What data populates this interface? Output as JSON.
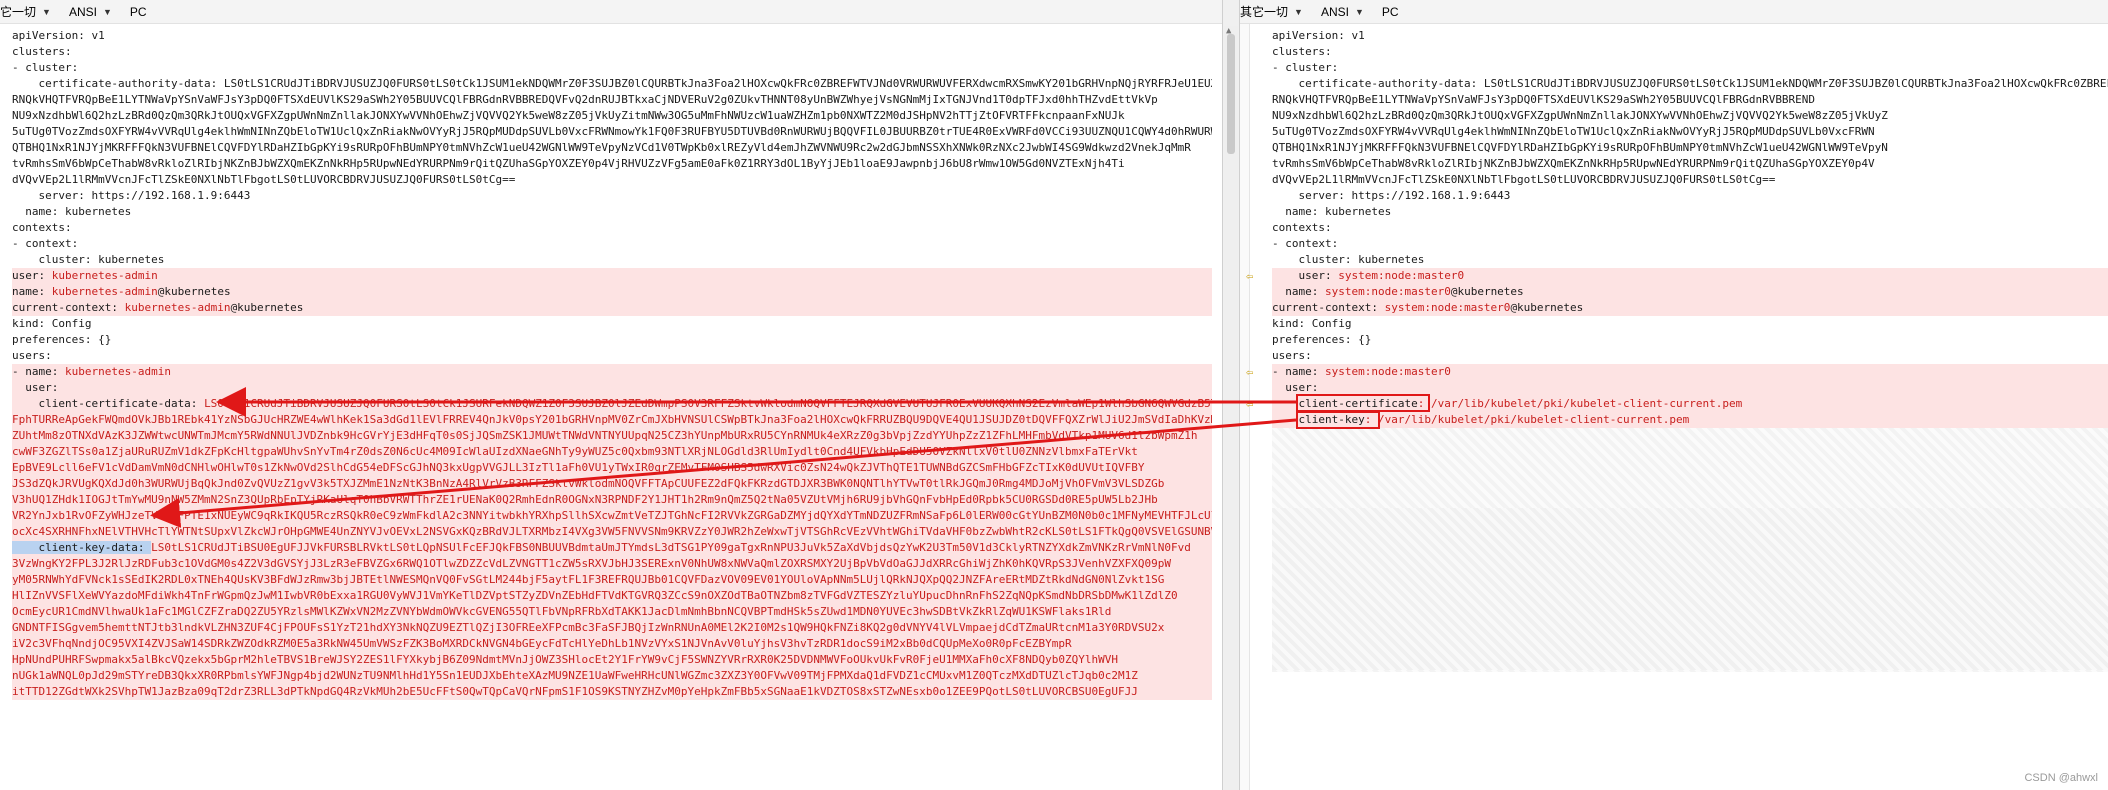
{
  "toolbar_left": {
    "encoding_menu": "它一切",
    "charset": "ANSI",
    "line_ending": "PC"
  },
  "toolbar_right": {
    "encoding_menu": "其它一切",
    "charset": "ANSI",
    "line_ending": "PC"
  },
  "left": {
    "lines": [
      {
        "t": "apiVersion: v1"
      },
      {
        "t": "clusters:"
      },
      {
        "t": "- cluster:"
      },
      {
        "t": "    certificate-authority-data: LS0tLS1CRUdJTiBDRVJUSUZJQ0FURS0tLS0tCk1JSUM1ekNDQWMrZ0F3SUJBZ0lCQURBTkJna3Foa2lHOXcwQkFRc0ZBREFWTVJNd0VRWURWUVFERXdwcmRXSmwKY201bGRHVnpNQjRYRFRJeU1EUXlNVEEyTkRJeU5Gb1hEVE15TURReE9EQTJOREl5TkZvd0ZURVRNQkVHQTFVRQpBeE1LYTNWaVpYSnVaWFJsY3pDQ0FTSXdEUVlKS29aSWh2Y05BUUVCQlFBRGdnRVBBREND"
      },
      {
        "t": "RNQkVHQTFVRQpBeE1LYTNWaVpYSnVaWFJsY3pDQ0FTSXdEUVlKS29aSWh2Y05BUUVCQlFBRGdnRVBBREDQVFvQ2dnRUJBTkxaCjNDVERuV2g0ZUkvTHNNT08yUnBWZWhyejVsNGNmMjIxTGNJVnd1T0dpTFJxd0hhTHZvdEttVkVp"
      },
      {
        "t": "NU9xNzdhbWl6Q2hzLzBRd0QzQm3QRkJtOUQxVGFXZgpUWnNmZnllakJONXYwVVNhOEhwZjVQVVQ2Yk5weW8zZ05jVkUyZitmNWw3OG5uMmFhNWUzcW1uaWZHZm1pb0NXWTZ2M0dJSHpNV2hTTjZtOFVRTFFkcnpaanFxNUJk"
      },
      {
        "t": "5uTUg0TVozZmdsOXFYRW4vVVRqUlg4eklhWmNINnZQbEloTW1UclQxZnRiakNwOVYyRjJ5RQpMUDdpSUVLb0VxcFRWNmowYk1FQ0F3RUFBYU5DTUVBd0RnWURWUjBQQVFIL0JBUURBZ0trTUE4R0ExVWRFd0VCCi93UUZNQU1CQWY4d0hRWURWUjBP"
      },
      {
        "t": "QTBHQ1NxR1NJYjMKRFFFQkN3VUFBNElCQVFDYlRDaHZIbGpKYi9sRURpOFhBUmNPY0tmNVhZcW1ueU42WGNlWW9TeVpyNzVCd1V0TWpKb0xlREZyVld4emJhZWVNWU9Rc2w2dGJbmNSSXhXNWk0RzNXc2JwbWI4SG9Wdkwzd2VnekJqMmR"
      },
      {
        "t": "tvRmhsSmV6bWpCeThabW8vRkloZlRIbjNKZnBJbWZXQmEKZnNkRHp5RUpwNEdYRURPNm9rQitQZUhaSGpYOXZEY0p4VjRHVUZzVFg5amE0aFk0Z1RRY3dOL1ByYjJEb1loaE9JawpnbjJ6bU8rWmw1OW5Gd0NVZTExNjh4Ti"
      },
      {
        "t": "dVQvVEp2L1lRMmVVcnJFcTlZSkE0NXlNbTlFbgotLS0tLUVORCBDRVJUSUZJQ0FURS0tLS0tCg=="
      },
      {
        "t": "    server: https://192.168.1.9:6443"
      },
      {
        "t": "  name: kubernetes"
      },
      {
        "t": "contexts:"
      },
      {
        "t": "- context:"
      },
      {
        "t": "    cluster: kubernetes"
      },
      {
        "t": "    user: kubernetes-admin",
        "diff": true,
        "rk": "user: ",
        "rv": "kubernetes-admin"
      },
      {
        "t": "  name: kubernetes-admin@kubernetes",
        "diff": true,
        "rk": "name: ",
        "rv": "kubernetes-admin",
        "rs": "@kubernetes"
      },
      {
        "t": "current-context: kubernetes-admin@kubernetes",
        "diff": true,
        "rk": "current-context: ",
        "rv": "kubernetes-admin",
        "rs": "@kubernetes"
      },
      {
        "t": "kind: Config"
      },
      {
        "t": "preferences: {}"
      },
      {
        "t": "users:"
      },
      {
        "t": "- name: kubernetes-admin",
        "diff": true,
        "rk": "- name: ",
        "rv": "kubernetes-admin"
      },
      {
        "t": "  user:",
        "diff": true
      },
      {
        "t": "    client-certificate-data: LS0tLS1CRUdJTiBDRVJUSUZJQ0FURS0tLS0tCk1JSURFekNDQWZ1Z0F3SUJBZ0lJZEdDWmpPS0V3RFFZSktvWklodmNOQVFFTEJRQXdGVEVUTUJFR0ExVUUKQXhNS2EzVmlaWEp1WlhSbGN6QWVGdzB5TWpBME1qRXdOalF5TWpSYUZ3MHlNekEwTWpFd05qUXlNalphTURReApGekFWQmdOVkJBb1REbk41YzNSbGJUcHRZWE4wWlhKek1Sa3dGd1lEVlFRREV4QnJkV0psY201bGRHVnpMV0ZrCmJXbHVNSUlCSWpBTkJna3Foa2lHOXcwQkFRRUZBQU9DQVE4QU1JSUJDZ0tDQVFFQXZrWlJiU2JmSVdIaDhKVzMKTDNVc0c1Tm1LS3ZDOU0rSVZTUmJYY0VXenZ",
        "diff": true,
        "red": true,
        "key": "    client-certificate-data: "
      },
      {
        "t": "FphTURReApGekFWQmdOVkJBb1REbk41YzNSbGJUcHRZWE4wWlhKek1Sa3dGd1lEVlFRREV4QnJkV0psY201bGRHVnpMV0ZrCmJXbHVNSUlCSWpBTkJna3Foa2lHOXcwQkFRRUZBQU9DQVE4QU1JSUJDZ0tDQVFFQXZrWlJiU2JmSVdIaDhKVzMKTDNVc0c1",
        "diff": true,
        "red": true
      },
      {
        "t": "ZUhtMm8zOTNXdVAzK3JZWWtwcUNWTmJMcmY5RWdNNUlJVDZnbk9HcGVrYjE3dHFqT0s0SjJQSmZSK1JMUWtTNWdVNTNYUUpqN25CZ3hYUnpMbURxRU5CYnRNMUk4eXRzZ0g3bVpjZzdYYUhpZzZ1ZFhLMHFmbVdVTkp1MUV6d1lzbWpmZ1h",
        "diff": true,
        "red": true
      },
      {
        "t": "cwWF3ZGZlTSs0a1ZjaURuRUZmV1dkZFpKcHltgpaWUhvSnYvTm4rZ0dsZ0N6cUc4M09IcWlaUIzdXNaeGNhTy9yWUZ5c0Qxbm93NTlXRjNLOGdld3RlUmIydlt0Cnd4UFVkbHpEdDU5OVZkNllxV0tlU0ZNNzVlbmxFaTErVkt",
        "diff": true,
        "red": true
      },
      {
        "t": "EpBVE9Lcll6eFV1cVdDamVmN0dCNHlwOHlwT0s1ZkNwOVd2SlhCdG54eDFScGJhNQ3kxUgpVVGJLL3IzTl1aFh0VU1yTWxIR0grZEMvTFM0SHBS5dwRXVic0ZsN24wQkZJVThQTE1TUWNBdGZCSmFHbGFZcTIxK0dUVUtIQVFBY",
        "diff": true,
        "red": true
      },
      {
        "t": "JS3dZQkJRVUgKQXdJd0h3WURWUjBqQkJnd0ZvQVUzZ1gvV3k5TXJZMmE1NzNtK3BnNzA4RlVrVzB3RFFZSktvWklodmNOQVFFTApCUUFEZ2dFQkFKRzdGTDJXR3BWK0NQNTlhYTVwT0tlRkJGQmJ0Rmg4MDJoMjVhOFVmV3VLSDZGb",
        "diff": true,
        "red": true
      },
      {
        "t": "V3hUQ1ZHdk1IOGJtTmYwMU9nNW5ZMmN2SnZ3QUpRbEpTYjRKaUlqT0hBbVRWTThrZE1rUENaK0Q2RmhEdnR0OGNxN3RPNDF2Y1JHT1h2Rm9nQmZ5Q2tNa05VZUtVMjh6RU9jbVhGQnFvbHpEd0Rpbk5CU0RGSDd0RE5pUW5Lb2JHb",
        "diff": true,
        "red": true
      },
      {
        "t": "VR2YnJxb1RvOFZyWHJzeTVrSDFPTE1xNUEyWC9qRkIKQU5RczRSQkR0eC9zWmFkdlA2c3NNYitwbkhYRXhpSllhSXcwZmtVeTZJTGhNcFI2RVVkZGRGaDZMYjdQYXdYTmNDZUZFRmNSaFp6L0lERW00cGtYUnBZM0N0b0c1MFNyMEVHTFJLcUl",
        "diff": true,
        "red": true
      },
      {
        "t": "ocXc4SXRHNFhxNElVTHVHcTlYWTNtSUpxVlZkcWJrOHpGMWE4UnZNYVJvOEVxL2NSVGxKQzBRdVJLTXRMbzI4VXg3VW5FNVVSNm9KRVZzY0JWR2hZeWxwTjVTSGhRcVEzVVhtWGhiTVdaVHF0bzZwbWhtR2cKLS0tLS1FTkQgQ0VSVElGSUNBVEUtLS0tLQo=",
        "diff": true,
        "red": true
      },
      {
        "t": "    client-key-data: LS0tLS1CRUdJTiBSU0EgUFJJVkFURSBLRVktLS0tLQpNSUlFcEFJQkFBS0NBUUVBdmtaUmJTYmdsL3dTSG1PY09gaTgxRnNPU3JuVk5ZaXdVbjdsQzYwK2U3Tm50V1d3CklyRTNZYXdkZmVNKzRrVmNlN0Fvd",
        "diff": true,
        "red": true,
        "key": "    client-key-data: ",
        "selected": true
      },
      {
        "t": "3VzWngKY2FPL3J2RlJzRDFub3c1OVdGM0s4Z2V3dGVSYjJ3LzR3eFBVZGx6RWQ1OTlwZDZZcVdLZVNGTT1cZW5sRXVJbHJ3SERExnV0NhUW8xNWVaQmlZOXRSMXY2UjBpVbVdOaGJJdXRRcGhiWjZhK0hKQVRpS3JVenhVZXFXQ09pW",
        "diff": true,
        "red": true
      },
      {
        "t": "yM05RNWhYdFVNck1sSEdIK2RDL0xTNEh4QUsKV3BFdWJzRmw3bjJBTEtlNWESMQnVQ0FvSGtLM244bjF5aytFL1F3REFRQUJBb01CQVFDazVOV09EV01YOUloVApNNm5LUjlQRkNJQXpQQ2JNZFAreERtMDZtRkdNdGN0NlZvkt1SG",
        "diff": true,
        "red": true
      },
      {
        "t": "HlIZnVVSFlXeWVYazdoMFdiWkh4TnFrWGpmQzJwM1IwbVR0bExxa1RGU0VyWVJ1VmYKeTlDZVptSTZyZDVnZEbHdFTVdKTGVRQ3ZCcS9nOXZOdTBaOTNZbm8zTVFGdVZTESZYzluYUpucDhnRnFhS2ZqNQpKSmdNbDRSbDMwK1lZdlZ0",
        "diff": true,
        "red": true
      },
      {
        "t": "OcmEycUR1CmdNVlhwaUk1aFc1MGlCZFZraDQ2ZU5YRzlsMWlKZWxVN2MzZVNYbWdmOWVkcGVENG55QTlFbVNpRFRbXdTAKK1JacDlmNmhBbnNCQVBPTmdHSk5sZUwd1MDN0YUVEc3hwSDBtVkZkRlZqWU1KSWFlaks1Rld",
        "diff": true,
        "red": true
      },
      {
        "t": "GNDNTFISGgvem5hemttNTJtb3lndkVLZHN3ZUF4CjFPOUFsS1YzT21hdXY3NkNQZU9EZTlQZjI3OFREeXFPcmBc3FaSFJBQjIzWnRNUnA0MEl2K2I0M2s1QW9HQkFNZi8KQ2g0dVNYV4lVLVmpaejdCdTZmaURtcnM1a3Y0RDVSU2x",
        "diff": true,
        "red": true
      },
      {
        "t": "iV2c3VFhqNndjOC95VXI4ZVJSaW14SDRkZWZOdkRZM0E5a3RkNW45UmVWSzFZK3BoMXRDCkNVGN4bGEycFdTcHlYeDhLb1NVzVYxS1NJVnAvV0luYjhsV3hvTzRDR1docS9iM2xBb0dCQUpMeXo0R0pFcEZBYmpR",
        "diff": true,
        "red": true
      },
      {
        "t": "HpNUndPUHRFSwpmakx5alBkcVQzekx5bGprM2hleTBVS1BreWJSY2ZES1lFYXkybjB6Z09NdmtMVnJjOWZ3SHlocEt2Y1FrYW9vCjF5SWNZYVRrRXR0K25DVDNMWVFoOUkvUkFvR0FjeU1MMXaFh0cXF8NDQyb0ZQYlhWVH",
        "diff": true,
        "red": true
      },
      {
        "t": "nUGk1aWNQL0pJd29mSTYreDB3QkxXR0RPbmlsYWFJNgp4bjd2WUNzTU9NMlhHd1Y5Sn1EUDJXbEhteXAzMU9NZE1UaWFweHRHcUNlWGZmc3ZXZ3Y0OFVwV09TMjFPMXdaQ1dFVDZ1cCMUxvM1Z0QTczMXdDTUZlcTJqb0c2M1Z",
        "diff": true,
        "red": true
      },
      {
        "t": "itTTD12ZGdtWXk2SVhpTW1JazBza09qT2drZ3RLL3dPTkNpdGQ4RzVkMUh2bE5UcFFtS0QwTQpCaVQrNFpmS1F1OS9KSTNYZHZvM0pYeHpkZmFBb5xSGNaaE1kVDZTOS8xSTZwNEsxb0o1ZEE9PQotLS0tLUVORCBSU0EgUFJJ",
        "diff": true,
        "red": true
      }
    ]
  },
  "right": {
    "lines": [
      {
        "t": "apiVersion: v1"
      },
      {
        "t": "clusters:"
      },
      {
        "t": "- cluster:"
      },
      {
        "t": "    certificate-authority-data: LS0tLS1CRUdJTiBDRVJUSUZJQ0FURS0tLS0tCk1JSUM1ekNDQWMrZ0F3SUJBZ0lCQURBTkJna3Foa2lHOXcwQkFRc0ZBREFWTVJNd0VRWURWUVFERXdwcmRXSmwKY201bGRHVnpNQjRYRFRJeU1EUXlNVEEy"
      },
      {
        "t": "RNQkVHQTFVRQpBeE1LYTNWaVpYSnVaWFJsY3pDQ0FTSXdEUVlKS29aSWh2Y05BUUVCQlFBRGdnRVBBREND"
      },
      {
        "t": "NU9xNzdhbWl6Q2hzLzBRd0QzQm3QRkJtOUQxVGFXZgpUWnNmZnllakJONXYwVVNhOEhwZjVQVVQ2Yk5weW8zZ05jVkUyZ"
      },
      {
        "t": "5uTUg0TVozZmdsOXFYRW4vVVRqUlg4eklhWmNINnZQbEloTW1UclQxZnRiakNwOVYyRjJ5RQpMUDdpSUVLb0VxcFRWN"
      },
      {
        "t": "QTBHQ1NxR1NJYjMKRFFFQkN3VUFBNElCQVFDYlRDaHZIbGpKYi9sRURpOFhBUmNPY0tmNVhZcW1ueU42WGNlWW9TeVpyN"
      },
      {
        "t": "tvRmhsSmV6bWpCeThabW8vRkloZlRIbjNKZnBJbWZXQmEKZnNkRHp5RUpwNEdYRURPNm9rQitQZUhaSGpYOXZEY0p4V"
      },
      {
        "t": "dVQvVEp2L1lRMmVVcnJFcTlZSkE0NXlNbTlFbgotLS0tLUVORCBDRVJUSUZJQ0FURS0tLS0tCg=="
      },
      {
        "t": "    server: https://192.168.1.9:6443"
      },
      {
        "t": "  name: kubernetes"
      },
      {
        "t": "contexts:"
      },
      {
        "t": "- context:"
      },
      {
        "t": "    cluster: kubernetes"
      },
      {
        "t": "    user: system:node:master0",
        "diff": true,
        "rk": "    user: ",
        "rv": "system:node:master0"
      },
      {
        "t": "  name: system:node:master0@kubernetes",
        "diff": true,
        "rk": "  name: ",
        "rv": "system:node:master0",
        "rs": "@kubernetes"
      },
      {
        "t": "current-context: system:node:master0@kubernetes",
        "diff": true,
        "rk": "current-context: ",
        "rv": "system:node:master0",
        "rs": "@kubernetes"
      },
      {
        "t": "kind: Config"
      },
      {
        "t": "preferences: {}"
      },
      {
        "t": "users:"
      },
      {
        "t": "- name: system:node:master0",
        "diff": true,
        "rk": "- name: ",
        "rv": "system:node:master0"
      },
      {
        "t": "  user:",
        "diff": true
      },
      {
        "t": "    client-certificate: /var/lib/kubelet/pki/kubelet-client-current.pem",
        "diff": true,
        "red": true,
        "rk": "    client-certificate",
        "rv": ": /var/lib/kubelet/pki/kubelet-client-current.pem"
      },
      {
        "t": "    client-key: /var/lib/kubelet/pki/kubelet-client-current.pem",
        "diff": true,
        "red": true,
        "rk": "    client-key",
        "rv": ": /var/lib/kubelet/pki/kubelet-client-current.pem"
      }
    ]
  },
  "watermark": "CSDN @ahwxl",
  "colors": {
    "diff_bg": "#fde3e3",
    "diff_text": "#c8201e",
    "callout": "#e01818",
    "marker": "#c79a00"
  }
}
